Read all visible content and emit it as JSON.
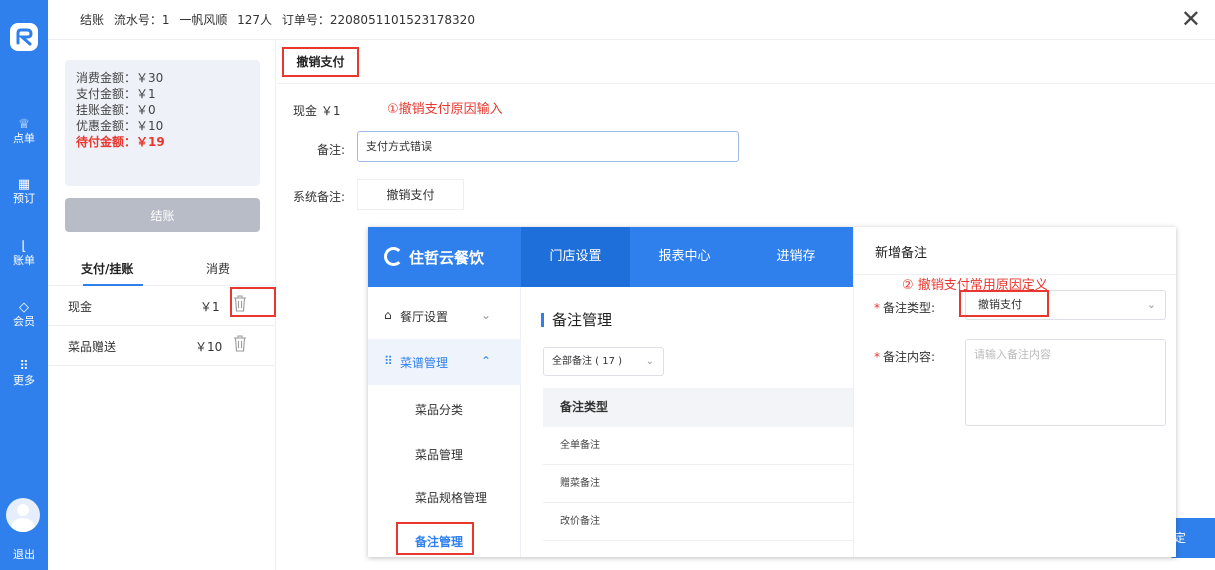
{
  "rail": {
    "items": [
      {
        "icon": "♕",
        "label": "点单"
      },
      {
        "icon": "▦",
        "label": "预订"
      },
      {
        "icon": "⌊",
        "label": "账单"
      },
      {
        "icon": "◇",
        "label": "会员"
      },
      {
        "icon": "⠿",
        "label": "更多"
      }
    ],
    "logout": "退出"
  },
  "header": {
    "title": "结账",
    "serial": "流水号：1",
    "table": "一帆风顺",
    "guests": "127人",
    "order": "订单号：2208051101523178320",
    "close": "✕"
  },
  "summary": {
    "consume": "消费金额：￥30",
    "paid": "支付金额：￥1",
    "credit": "挂账金额：￥0",
    "discount": "优惠金额：￥10",
    "due": "待付金额：￥19"
  },
  "settle_button": "结账",
  "left_tabs": {
    "pay": "支付/挂账",
    "consume": "消费"
  },
  "payments": [
    {
      "name": "现金",
      "amount": "￥1"
    },
    {
      "name": "菜品赠送",
      "amount": "￥10"
    }
  ],
  "main": {
    "tab": "撤销支付",
    "cash": "现金 ￥1",
    "step1": "①撤销支付原因输入",
    "remark_label": "备注:",
    "remark_value": "支付方式错误",
    "sys_label": "系统备注:",
    "sys_chip": "撤销支付",
    "confirm": "定"
  },
  "overlay": {
    "brand": "住哲云餐饮",
    "nav": [
      "门店设置",
      "报表中心",
      "进销存"
    ],
    "side_group1": "餐厅设置",
    "side_group2": "菜谱管理",
    "side_subs": [
      "菜品分类",
      "菜品管理",
      "菜品规格管理",
      "备注管理"
    ],
    "page_title": "备注管理",
    "filter": "全部备注 ( 17 )",
    "table_head": "备注类型",
    "table_rows": [
      "全单备注",
      "赠菜备注",
      "改价备注"
    ],
    "drawer_title": "新增备注",
    "step2": "② 撤销支付常用原因定义",
    "type_label": "备注类型:",
    "type_value": "撤销支付",
    "content_label": "备注内容:",
    "content_placeholder": "请输入备注内容"
  }
}
